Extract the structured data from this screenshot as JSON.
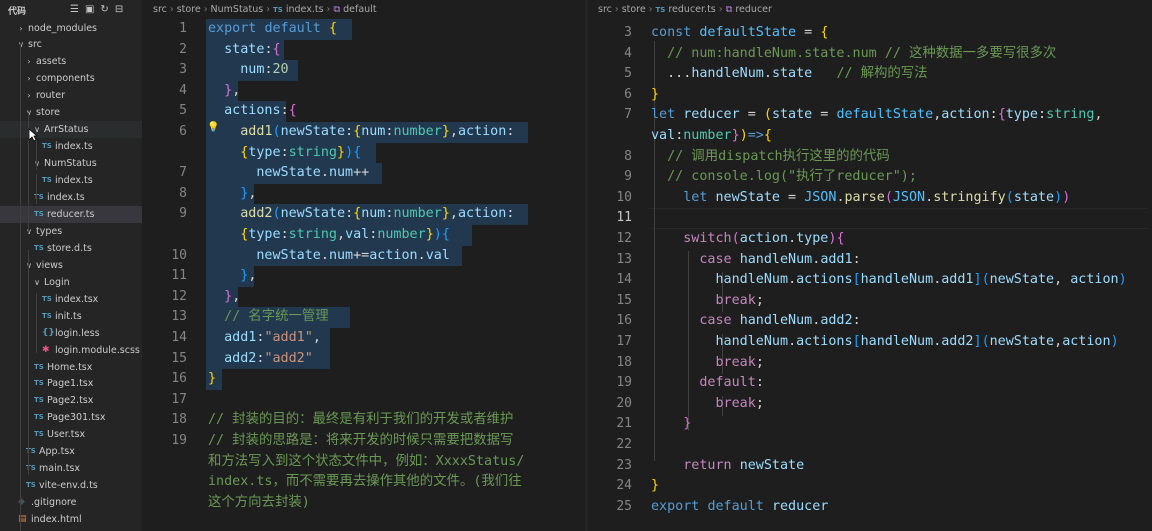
{
  "explorer": {
    "title": "代码",
    "actions": [
      "new-file",
      "new-folder",
      "refresh",
      "collapse-all"
    ],
    "items": [
      {
        "label": "node_modules",
        "kind": "folder",
        "depth": 1,
        "open": false
      },
      {
        "label": "src",
        "kind": "folder",
        "depth": 1,
        "open": true
      },
      {
        "label": "assets",
        "kind": "folder",
        "depth": 2,
        "open": false
      },
      {
        "label": "components",
        "kind": "folder",
        "depth": 2,
        "open": false
      },
      {
        "label": "router",
        "kind": "folder",
        "depth": 2,
        "open": false
      },
      {
        "label": "store",
        "kind": "folder",
        "depth": 2,
        "open": true
      },
      {
        "label": "ArrStatus",
        "kind": "folder",
        "depth": 3,
        "open": true
      },
      {
        "label": "index.ts",
        "kind": "ts",
        "depth": 4
      },
      {
        "label": "NumStatus",
        "kind": "folder",
        "depth": 3,
        "open": true
      },
      {
        "label": "index.ts",
        "kind": "ts",
        "depth": 4
      },
      {
        "label": "index.ts",
        "kind": "ts",
        "depth": 3
      },
      {
        "label": "reducer.ts",
        "kind": "ts",
        "depth": 3,
        "active": true
      },
      {
        "label": "types",
        "kind": "folder",
        "depth": 2,
        "open": true
      },
      {
        "label": "store.d.ts",
        "kind": "ts",
        "depth": 3
      },
      {
        "label": "views",
        "kind": "folder",
        "depth": 2,
        "open": true
      },
      {
        "label": "Login",
        "kind": "folder",
        "depth": 3,
        "open": true
      },
      {
        "label": "index.tsx",
        "kind": "ts",
        "depth": 4
      },
      {
        "label": "init.ts",
        "kind": "ts",
        "depth": 4
      },
      {
        "label": "login.less",
        "kind": "css",
        "depth": 4
      },
      {
        "label": "login.module.scss",
        "kind": "scss",
        "depth": 4
      },
      {
        "label": "Home.tsx",
        "kind": "ts",
        "depth": 3
      },
      {
        "label": "Page1.tsx",
        "kind": "ts",
        "depth": 3
      },
      {
        "label": "Page2.tsx",
        "kind": "ts",
        "depth": 3
      },
      {
        "label": "Page301.tsx",
        "kind": "ts",
        "depth": 3
      },
      {
        "label": "User.tsx",
        "kind": "ts",
        "depth": 3
      },
      {
        "label": "App.tsx",
        "kind": "ts",
        "depth": 2
      },
      {
        "label": "main.tsx",
        "kind": "ts",
        "depth": 2
      },
      {
        "label": "vite-env.d.ts",
        "kind": "ts",
        "depth": 2
      },
      {
        "label": ".gitignore",
        "kind": "git",
        "depth": 1
      },
      {
        "label": "index.html",
        "kind": "html",
        "depth": 1
      }
    ]
  },
  "left_editor": {
    "breadcrumb": [
      "src",
      "store",
      "NumStatus",
      "index.ts",
      "default"
    ],
    "line_numbers": [
      "1",
      "2",
      "3",
      "4",
      "5",
      "6",
      "",
      "7",
      "8",
      "9",
      "",
      "10",
      "11",
      "12",
      "13",
      "14",
      "15",
      "16",
      "17",
      "18",
      "19",
      "",
      "",
      ""
    ],
    "lines": [
      [
        [
          "kw",
          "export "
        ],
        [
          "kw",
          "default "
        ],
        [
          "b1",
          "{"
        ]
      ],
      [
        [
          "",
          "  "
        ],
        [
          "prop",
          "state"
        ],
        [
          "",
          ":"
        ],
        [
          "b2",
          "{"
        ]
      ],
      [
        [
          "",
          "    "
        ],
        [
          "prop",
          "num"
        ],
        [
          "",
          ":"
        ],
        [
          "num",
          "20"
        ]
      ],
      [
        [
          "",
          "  "
        ],
        [
          "b2",
          "}"
        ],
        [
          "",
          ","
        ]
      ],
      [
        [
          "",
          "  "
        ],
        [
          "prop",
          "actions"
        ],
        [
          "",
          ":"
        ],
        [
          "b2",
          "{"
        ]
      ],
      [
        [
          "",
          "    "
        ],
        [
          "fn",
          "add1"
        ],
        [
          "b3",
          "("
        ],
        [
          "prop",
          "newState"
        ],
        [
          "",
          ":"
        ],
        [
          "b1",
          "{"
        ],
        [
          "prop",
          "num"
        ],
        [
          "",
          ":"
        ],
        [
          "typ",
          "number"
        ],
        [
          "b1",
          "}"
        ],
        [
          "",
          ","
        ],
        [
          "prop",
          "action"
        ],
        [
          "",
          ":"
        ]
      ],
      [
        [
          "",
          "    "
        ],
        [
          "b1",
          "{"
        ],
        [
          "prop",
          "type"
        ],
        [
          "",
          ":"
        ],
        [
          "typ",
          "string"
        ],
        [
          "b1",
          "}"
        ],
        [
          "b3",
          ")"
        ],
        [
          "b3",
          "{"
        ]
      ],
      [
        [
          "",
          "      "
        ],
        [
          "prop",
          "newState"
        ],
        [
          "",
          "."
        ],
        [
          "prop",
          "num"
        ],
        [
          "",
          "++"
        ]
      ],
      [
        [
          "",
          "    "
        ],
        [
          "b3",
          "}"
        ],
        [
          "",
          ","
        ]
      ],
      [
        [
          "",
          "    "
        ],
        [
          "fn",
          "add2"
        ],
        [
          "b3",
          "("
        ],
        [
          "prop",
          "newState"
        ],
        [
          "",
          ":"
        ],
        [
          "b1",
          "{"
        ],
        [
          "prop",
          "num"
        ],
        [
          "",
          ":"
        ],
        [
          "typ",
          "number"
        ],
        [
          "b1",
          "}"
        ],
        [
          "",
          ","
        ],
        [
          "prop",
          "action"
        ],
        [
          "",
          ":"
        ]
      ],
      [
        [
          "",
          "    "
        ],
        [
          "b1",
          "{"
        ],
        [
          "prop",
          "type"
        ],
        [
          "",
          ":"
        ],
        [
          "typ",
          "string"
        ],
        [
          "",
          ","
        ],
        [
          "prop",
          "val"
        ],
        [
          "",
          ":"
        ],
        [
          "typ",
          "number"
        ],
        [
          "b1",
          "}"
        ],
        [
          "b3",
          ")"
        ],
        [
          "b3",
          "{"
        ]
      ],
      [
        [
          "",
          "      "
        ],
        [
          "prop",
          "newState"
        ],
        [
          "",
          "."
        ],
        [
          "prop",
          "num"
        ],
        [
          "",
          "+="
        ],
        [
          "prop",
          "action"
        ],
        [
          "",
          "."
        ],
        [
          "prop",
          "val"
        ]
      ],
      [
        [
          "",
          "    "
        ],
        [
          "b3",
          "}"
        ],
        [
          "",
          ","
        ]
      ],
      [
        [
          "",
          "  "
        ],
        [
          "b2",
          "}"
        ],
        [
          "",
          ","
        ]
      ],
      [
        [
          "",
          "  "
        ],
        [
          "cm",
          "// 名字统一管理"
        ]
      ],
      [
        [
          "",
          "  "
        ],
        [
          "prop",
          "add1"
        ],
        [
          "",
          ":"
        ],
        [
          "str",
          "\"add1\""
        ],
        [
          "",
          ","
        ]
      ],
      [
        [
          "",
          "  "
        ],
        [
          "prop",
          "add2"
        ],
        [
          "",
          ":"
        ],
        [
          "str",
          "\"add2\""
        ]
      ],
      [
        [
          "b1",
          "}"
        ]
      ],
      [
        [
          "",
          ""
        ]
      ],
      [
        [
          "cm",
          "// 封装的目的：最终是有利于我们的开发或者维护"
        ]
      ],
      [
        [
          "cm",
          "// 封装的思路是：将来开发的时候只需要把数据写"
        ]
      ],
      [
        [
          "cm",
          "和方法写入到这个状态文件中，例如：XxxxStatus/"
        ]
      ],
      [
        [
          "cm",
          "index.ts，而不需要再去操作其他的文件。(我们往"
        ]
      ],
      [
        [
          "cm",
          "这个方向去封装)"
        ]
      ]
    ]
  },
  "right_editor": {
    "breadcrumb": [
      "src",
      "store",
      "reducer.ts",
      "reducer"
    ],
    "line_numbers": [
      "3",
      "4",
      "5",
      "6",
      "7",
      "",
      "8",
      "9",
      "10",
      "11",
      "12",
      "13",
      "14",
      "15",
      "16",
      "17",
      "18",
      "19",
      "20",
      "21",
      "22",
      "23",
      "24",
      "25"
    ],
    "current_line": "11",
    "lines": [
      [
        [
          "kw",
          "const "
        ],
        [
          "var",
          "defaultState"
        ],
        [
          "",
          " = "
        ],
        [
          "b1",
          "{"
        ]
      ],
      [
        [
          "",
          "  "
        ],
        [
          "cm",
          "// num:handleNum.state.num // 这种数据一多要写很多次"
        ]
      ],
      [
        [
          "",
          "  ..."
        ],
        [
          "prop",
          "handleNum"
        ],
        [
          "",
          "."
        ],
        [
          "prop",
          "state"
        ],
        [
          "",
          "   "
        ],
        [
          "cm",
          "// 解构的写法"
        ]
      ],
      [
        [
          "b1",
          "}"
        ]
      ],
      [
        [
          "kw",
          "let "
        ],
        [
          "prop",
          "reducer"
        ],
        [
          "",
          " = "
        ],
        [
          "b1",
          "("
        ],
        [
          "prop",
          "state"
        ],
        [
          "",
          " = "
        ],
        [
          "var",
          "defaultState"
        ],
        [
          "",
          ","
        ],
        [
          "prop",
          "action"
        ],
        [
          "",
          ":"
        ],
        [
          "b2",
          "{"
        ],
        [
          "prop",
          "type"
        ],
        [
          "",
          ":"
        ],
        [
          "typ",
          "string"
        ],
        [
          "",
          ","
        ]
      ],
      [
        [
          "prop",
          "val"
        ],
        [
          "",
          ":"
        ],
        [
          "typ",
          "number"
        ],
        [
          "b2",
          "}"
        ],
        [
          "b1",
          ")"
        ],
        [
          "kw",
          "=>"
        ],
        [
          "b1",
          "{"
        ]
      ],
      [
        [
          "",
          "  "
        ],
        [
          "cm",
          "// 调用dispatch执行这里的的代码"
        ]
      ],
      [
        [
          "",
          "  "
        ],
        [
          "cm",
          "// console.log(\"执行了reducer\");"
        ]
      ],
      [
        [
          "",
          "    "
        ],
        [
          "kw",
          "let "
        ],
        [
          "prop",
          "newState"
        ],
        [
          "",
          " = "
        ],
        [
          "var",
          "JSON"
        ],
        [
          "",
          "."
        ],
        [
          "fn",
          "parse"
        ],
        [
          "b2",
          "("
        ],
        [
          "var",
          "JSON"
        ],
        [
          "",
          "."
        ],
        [
          "fn",
          "stringify"
        ],
        [
          "b3",
          "("
        ],
        [
          "prop",
          "state"
        ],
        [
          "b3",
          ")"
        ],
        [
          "b2",
          ")"
        ]
      ],
      [
        [
          "",
          ""
        ]
      ],
      [
        [
          "",
          "    "
        ],
        [
          "ctl",
          "switch"
        ],
        [
          "b2",
          "("
        ],
        [
          "prop",
          "action"
        ],
        [
          "",
          "."
        ],
        [
          "prop",
          "type"
        ],
        [
          "b2",
          ")"
        ],
        [
          "b2",
          "{"
        ]
      ],
      [
        [
          "",
          "      "
        ],
        [
          "ctl",
          "case "
        ],
        [
          "prop",
          "handleNum"
        ],
        [
          "",
          "."
        ],
        [
          "prop",
          "add1"
        ],
        [
          "",
          ":"
        ]
      ],
      [
        [
          "",
          "        "
        ],
        [
          "prop",
          "handleNum"
        ],
        [
          "",
          "."
        ],
        [
          "prop",
          "actions"
        ],
        [
          "b3",
          "["
        ],
        [
          "prop",
          "handleNum"
        ],
        [
          "",
          "."
        ],
        [
          "prop",
          "add1"
        ],
        [
          "b3",
          "]"
        ],
        [
          "b3",
          "("
        ],
        [
          "prop",
          "newState"
        ],
        [
          "",
          ", "
        ],
        [
          "prop",
          "action"
        ],
        [
          "b3",
          ")"
        ]
      ],
      [
        [
          "",
          "        "
        ],
        [
          "ctl",
          "break"
        ],
        [
          "",
          ";"
        ]
      ],
      [
        [
          "",
          "      "
        ],
        [
          "ctl",
          "case "
        ],
        [
          "prop",
          "handleNum"
        ],
        [
          "",
          "."
        ],
        [
          "prop",
          "add2"
        ],
        [
          "",
          ":"
        ]
      ],
      [
        [
          "",
          "        "
        ],
        [
          "prop",
          "handleNum"
        ],
        [
          "",
          "."
        ],
        [
          "prop",
          "actions"
        ],
        [
          "b3",
          "["
        ],
        [
          "prop",
          "handleNum"
        ],
        [
          "",
          "."
        ],
        [
          "prop",
          "add2"
        ],
        [
          "b3",
          "]"
        ],
        [
          "b3",
          "("
        ],
        [
          "prop",
          "newState"
        ],
        [
          "",
          ","
        ],
        [
          "prop",
          "action"
        ],
        [
          "b3",
          ")"
        ]
      ],
      [
        [
          "",
          "        "
        ],
        [
          "ctl",
          "break"
        ],
        [
          "",
          ";"
        ]
      ],
      [
        [
          "",
          "      "
        ],
        [
          "ctl",
          "default"
        ],
        [
          "",
          ":"
        ]
      ],
      [
        [
          "",
          "        "
        ],
        [
          "ctl",
          "break"
        ],
        [
          "",
          ";"
        ]
      ],
      [
        [
          "",
          "    "
        ],
        [
          "b2",
          "}"
        ]
      ],
      [
        [
          "",
          ""
        ]
      ],
      [
        [
          "",
          "    "
        ],
        [
          "ctl",
          "return "
        ],
        [
          "prop",
          "newState"
        ]
      ],
      [
        [
          "b1",
          "}"
        ]
      ],
      [
        [
          "kw",
          "export "
        ],
        [
          "kw",
          "default "
        ],
        [
          "prop",
          "reducer"
        ]
      ]
    ]
  },
  "colors": {
    "editor_bg": "#1e1e1e",
    "sidebar_bg": "#252526",
    "selection": "#264f78"
  }
}
